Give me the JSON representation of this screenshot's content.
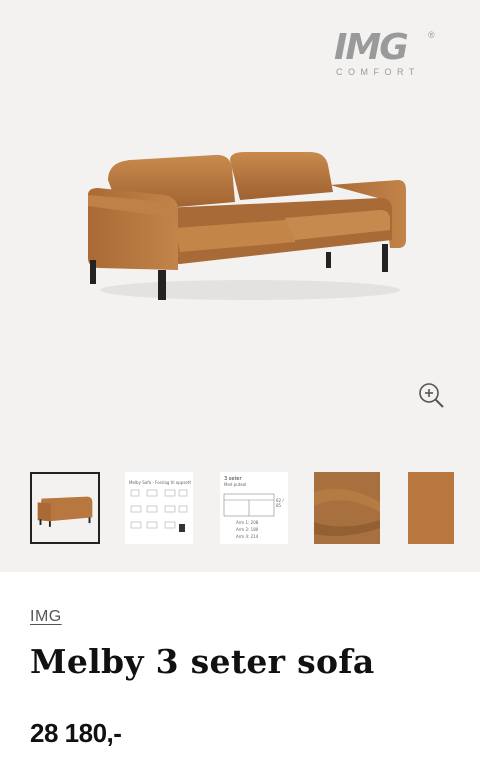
{
  "gallery": {
    "logo": {
      "mark": "IMG",
      "registered": "®",
      "sub": "COMFORT"
    },
    "hero_image": "sofa-brown-leather",
    "zoom_icon": "zoom-in-icon",
    "thumbnails": [
      {
        "name": "sofa-photo",
        "active": true
      },
      {
        "name": "dimension-sheet",
        "text": "Melby Sofa - Forslag til oppsett",
        "active": false
      },
      {
        "name": "size-drawing",
        "title": "3 seter",
        "subtitle": "Med puteol",
        "lines": [
          "Arm 1: 208",
          "Arm 2: 180",
          "Arm 4: 214"
        ],
        "height": "62 / 85",
        "active": false
      },
      {
        "name": "leather-swatch",
        "active": false
      },
      {
        "name": "color-swatch",
        "active": false
      }
    ]
  },
  "product": {
    "brand": "IMG",
    "title": "Melby 3 seter sofa",
    "price": "28 180,-"
  },
  "colors": {
    "leather": "#b8773e",
    "gallery_bg": "#f3f2f1"
  }
}
